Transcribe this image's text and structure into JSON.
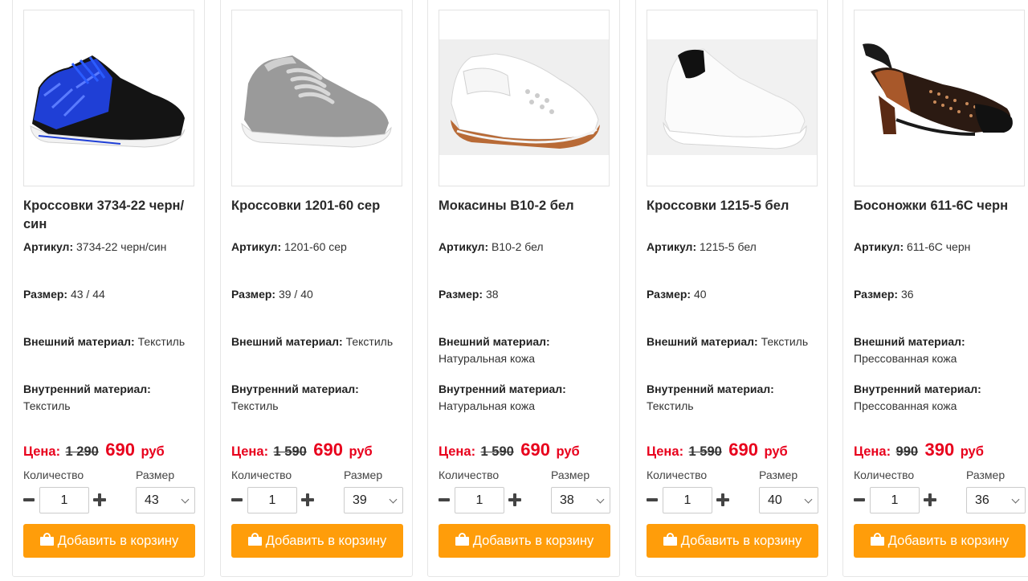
{
  "labels": {
    "article": "Артикул:",
    "size": "Размер:",
    "outer": "Внешний материал:",
    "inner": "Внутренний материал:",
    "price": "Цена:",
    "currency": "руб",
    "qty_label": "Количество",
    "size_label": "Размер",
    "add_to_cart": "Добавить в корзину"
  },
  "colors": {
    "accent": "#ff9d0a",
    "price": "#e8001c"
  },
  "products": [
    {
      "title": "Кроссовки 3734-22 черн/син",
      "article": "3734-22 черн/син",
      "size": "43 / 44",
      "outer": "Текстиль",
      "inner": "Текстиль",
      "old_price": "1 290",
      "new_price": "690",
      "qty": "1",
      "selected_size": "43",
      "image_icon": "sneaker-black-blue-image"
    },
    {
      "title": "Кроссовки 1201-60 сер",
      "article": "1201-60 сер",
      "size": "39 / 40",
      "outer": "Текстиль",
      "inner": "Текстиль",
      "old_price": "1 590",
      "new_price": "690",
      "qty": "1",
      "selected_size": "39",
      "image_icon": "sneaker-grey-image"
    },
    {
      "title": "Мокасины B10-2 бел",
      "article": "B10-2 бел",
      "size": "38",
      "outer": "Натуральная кожа",
      "inner": "Натуральная кожа",
      "old_price": "1 590",
      "new_price": "690",
      "qty": "1",
      "selected_size": "38",
      "image_icon": "moccasin-white-image"
    },
    {
      "title": "Кроссовки 1215-5 бел",
      "article": "1215-5 бел",
      "size": "40",
      "outer": "Текстиль",
      "inner": "Текстиль",
      "old_price": "1 590",
      "new_price": "690",
      "qty": "1",
      "selected_size": "40",
      "image_icon": "sneaker-white-image"
    },
    {
      "title": "Босоножки 611-6C черн",
      "article": "611-6C черн",
      "size": "36",
      "outer": "Прессованная кожа",
      "inner": "Прессованная кожа",
      "old_price": "990",
      "new_price": "390",
      "qty": "1",
      "selected_size": "36",
      "image_icon": "sandal-black-image"
    }
  ]
}
